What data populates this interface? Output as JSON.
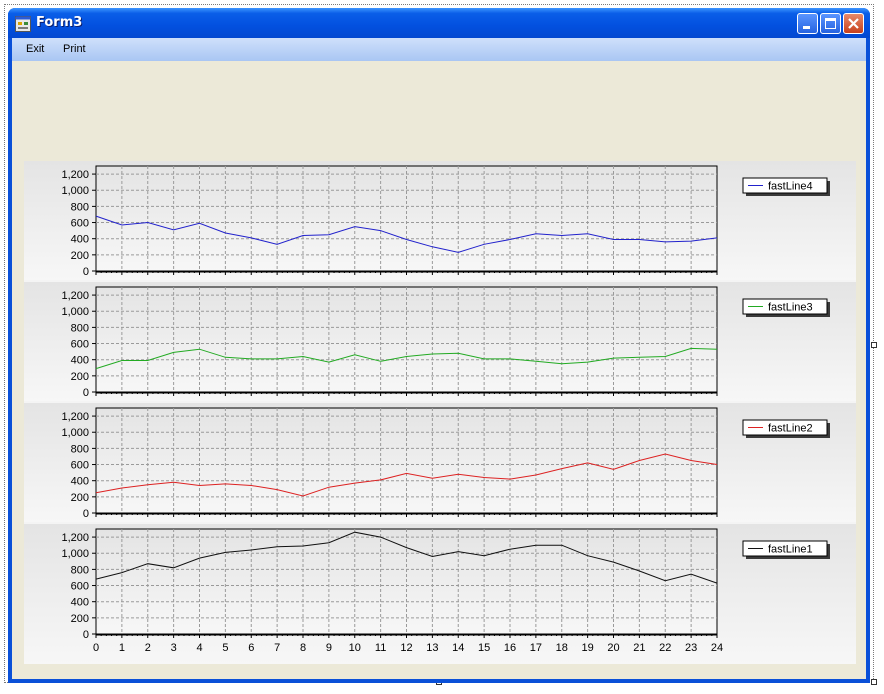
{
  "window": {
    "title": "Form3",
    "icon": "form-app-icon",
    "controls": [
      "minimize-icon",
      "maximize-icon",
      "close-icon"
    ]
  },
  "menu": {
    "exit_label": "Exit",
    "print_label": "Print"
  },
  "chart_data": [
    {
      "type": "line",
      "x": [
        0,
        1,
        2,
        3,
        4,
        5,
        6,
        7,
        8,
        9,
        10,
        11,
        12,
        13,
        14,
        15,
        16,
        17,
        18,
        19,
        20,
        21,
        22,
        23,
        24
      ],
      "series": [
        {
          "name": "fastLine4",
          "color": "#2222cc",
          "values": [
            680,
            570,
            600,
            510,
            590,
            470,
            410,
            330,
            440,
            450,
            550,
            500,
            390,
            300,
            230,
            330,
            390,
            460,
            440,
            460,
            390,
            390,
            360,
            370,
            410
          ]
        }
      ],
      "ylim": [
        0,
        1300
      ],
      "yticks": [
        0,
        200,
        400,
        600,
        800,
        1000,
        1200
      ],
      "yticklabels": [
        "0",
        "200",
        "400",
        "600",
        "800",
        "1,000",
        "1,200"
      ],
      "grid": true,
      "legend": "right"
    },
    {
      "type": "line",
      "x": [
        0,
        1,
        2,
        3,
        4,
        5,
        6,
        7,
        8,
        9,
        10,
        11,
        12,
        13,
        14,
        15,
        16,
        17,
        18,
        19,
        20,
        21,
        22,
        23,
        24
      ],
      "series": [
        {
          "name": "fastLine3",
          "color": "#22aa22",
          "values": [
            290,
            390,
            390,
            490,
            530,
            430,
            410,
            410,
            440,
            370,
            460,
            380,
            440,
            470,
            480,
            410,
            410,
            380,
            350,
            370,
            420,
            430,
            440,
            540,
            530
          ]
        }
      ],
      "ylim": [
        0,
        1300
      ],
      "yticks": [
        0,
        200,
        400,
        600,
        800,
        1000,
        1200
      ],
      "yticklabels": [
        "0",
        "200",
        "400",
        "600",
        "800",
        "1,000",
        "1,200"
      ],
      "grid": true,
      "legend": "right"
    },
    {
      "type": "line",
      "x": [
        0,
        1,
        2,
        3,
        4,
        5,
        6,
        7,
        8,
        9,
        10,
        11,
        12,
        13,
        14,
        15,
        16,
        17,
        18,
        19,
        20,
        21,
        22,
        23,
        24
      ],
      "series": [
        {
          "name": "fastLine2",
          "color": "#dd2222",
          "values": [
            250,
            310,
            350,
            380,
            340,
            360,
            340,
            290,
            210,
            320,
            370,
            410,
            490,
            430,
            480,
            440,
            420,
            470,
            550,
            620,
            540,
            650,
            730,
            650,
            600
          ]
        }
      ],
      "ylim": [
        0,
        1300
      ],
      "yticks": [
        0,
        200,
        400,
        600,
        800,
        1000,
        1200
      ],
      "yticklabels": [
        "0",
        "200",
        "400",
        "600",
        "800",
        "1,000",
        "1,200"
      ],
      "grid": true,
      "legend": "right"
    },
    {
      "type": "line",
      "x": [
        0,
        1,
        2,
        3,
        4,
        5,
        6,
        7,
        8,
        9,
        10,
        11,
        12,
        13,
        14,
        15,
        16,
        17,
        18,
        19,
        20,
        21,
        22,
        23,
        24
      ],
      "xticklabels": [
        "0",
        "1",
        "2",
        "3",
        "4",
        "5",
        "6",
        "7",
        "8",
        "9",
        "10",
        "11",
        "12",
        "13",
        "14",
        "15",
        "16",
        "17",
        "18",
        "19",
        "20",
        "21",
        "22",
        "23",
        "24"
      ],
      "series": [
        {
          "name": "fastLine1",
          "color": "#111111",
          "values": [
            680,
            760,
            870,
            820,
            940,
            1010,
            1040,
            1080,
            1090,
            1130,
            1260,
            1200,
            1070,
            960,
            1020,
            970,
            1050,
            1100,
            1100,
            970,
            890,
            780,
            660,
            740,
            630
          ]
        }
      ],
      "ylim": [
        0,
        1300
      ],
      "yticks": [
        0,
        200,
        400,
        600,
        800,
        1000,
        1200
      ],
      "yticklabels": [
        "0",
        "200",
        "400",
        "600",
        "800",
        "1,000",
        "1,200"
      ],
      "grid": true,
      "legend": "right"
    }
  ]
}
